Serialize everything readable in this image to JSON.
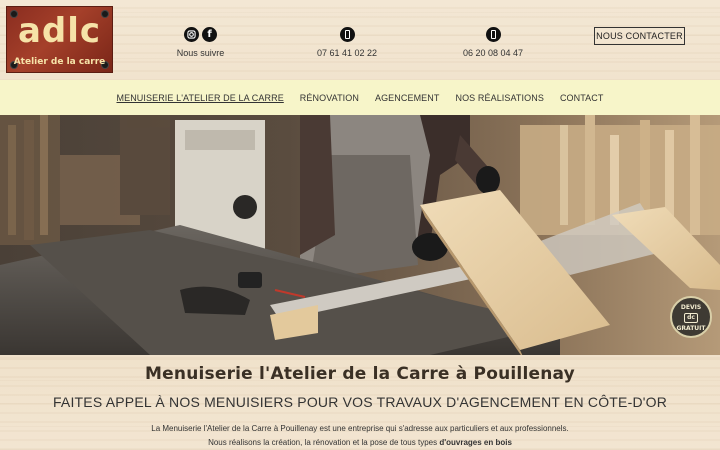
{
  "header": {
    "logo": {
      "mark": "adlc",
      "tagline": "Atelier de la carre"
    },
    "social": {
      "label": "Nous suivre",
      "icons": [
        "instagram-icon",
        "facebook-icon"
      ]
    },
    "phone_1": {
      "number": "07 61 41 02 22",
      "icon": "mobile-phone-icon"
    },
    "phone_2": {
      "number": "06 20 08 04 47",
      "icon": "mobile-phone-icon"
    },
    "contact_button": "NOUS CONTACTER"
  },
  "nav": {
    "items": [
      {
        "label": "MENUISERIE L'ATELIER DE LA CARRE",
        "active": true
      },
      {
        "label": "RÉNOVATION",
        "active": false
      },
      {
        "label": "AGENCEMENT",
        "active": false
      },
      {
        "label": "NOS RÉALISATIONS",
        "active": false
      },
      {
        "label": "CONTACT",
        "active": false
      }
    ]
  },
  "hero": {
    "badge": {
      "line1": "DEVIS",
      "line2": "GRATUIT"
    }
  },
  "content": {
    "title": "Menuiserie l'Atelier de la Carre à Pouillenay",
    "subtitle": "FAITES APPEL À NOS MENUISIERS POUR VOS TRAVAUX D'AGENCEMENT EN CÔTE-D'OR",
    "paragraph_1": "La Menuiserie l'Atelier de la Carre à Pouillenay est une entreprise qui s'adresse aux particuliers et aux professionnels.",
    "paragraph_2_start": "Nous réalisons la création, la rénovation et la pose de tous types ",
    "paragraph_2_bold": "d'ouvrages en bois"
  },
  "colors": {
    "nav_background": "#f7f5c9",
    "logo_background": "#8a2d20",
    "logo_text": "#f6e3a8"
  }
}
